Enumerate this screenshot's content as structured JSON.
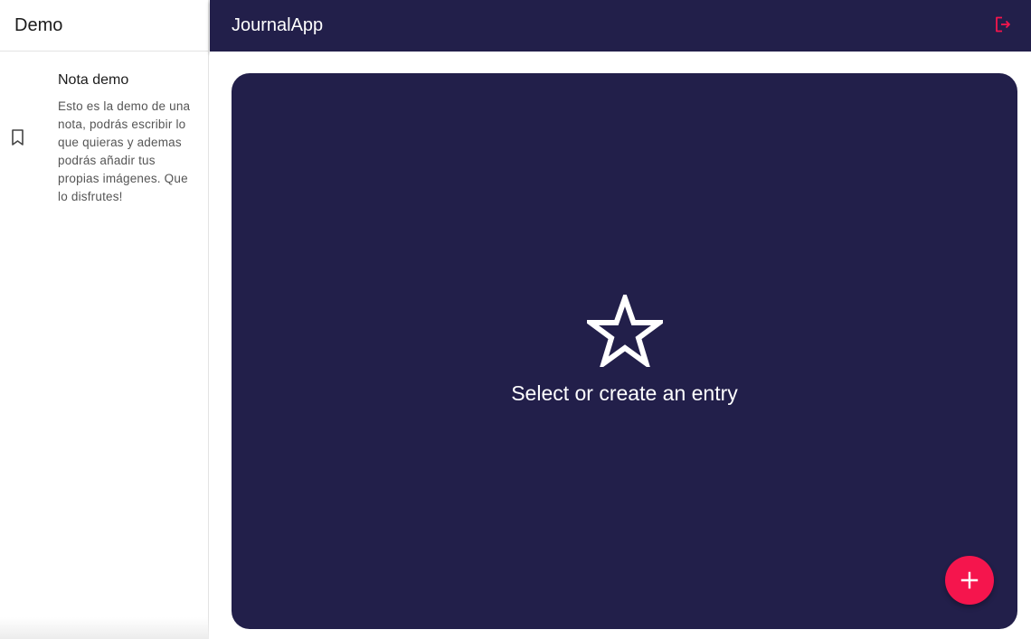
{
  "sidebar": {
    "title": "Demo",
    "notes": [
      {
        "title": "Nota demo",
        "body": "Esto es la demo de una nota, podrás escribir lo que quieras y ademas podrás añadir tus propias imágenes. Que lo disfrutes!",
        "icon": "bookmark-icon"
      }
    ]
  },
  "topbar": {
    "title": "JournalApp",
    "logout_icon": "logout-icon"
  },
  "main": {
    "empty_state": {
      "icon": "star-outline-icon",
      "text": "Select or create an entry"
    },
    "fab_icon": "add-icon"
  },
  "colors": {
    "primary": "#221f4a",
    "accent": "#f5154d",
    "background": "#ffffff"
  }
}
